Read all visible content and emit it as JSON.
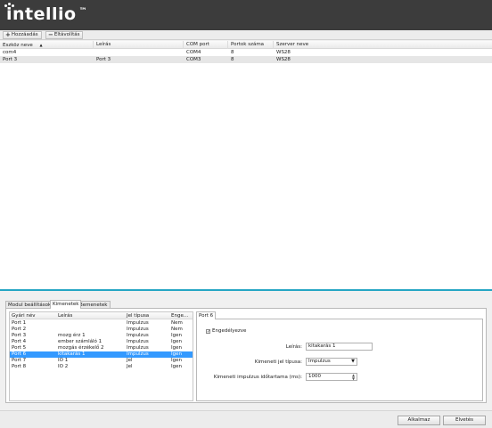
{
  "brand": {
    "name": "intellio",
    "tm": "™"
  },
  "toolbar": {
    "add_label": "Hozzáadás",
    "remove_label": "Eltávolítás"
  },
  "grid": {
    "headers": [
      "Eszköz neve",
      "Leírás",
      "COM port",
      "Portok száma",
      "Szerver neve"
    ],
    "rows": [
      [
        "com4",
        "",
        "COM4",
        "8",
        "WS28"
      ],
      [
        "Port 3",
        "Port 3",
        "COM3",
        "8",
        "WS28"
      ]
    ]
  },
  "tabs": [
    "Modul beállítások",
    "Kimenetek",
    "Bemenetek"
  ],
  "ports": {
    "headers": [
      "Gyári név",
      "Leírás",
      "Jel típusa",
      "Enge..."
    ],
    "rows": [
      [
        "Port 1",
        "",
        "Impulzus",
        "Nem"
      ],
      [
        "Port 2",
        "",
        "Impulzus",
        "Nem"
      ],
      [
        "Port 3",
        "mozg érz 1",
        "Impulzus",
        "Igen"
      ],
      [
        "Port 4",
        "ember számláló 1",
        "Impulzus",
        "Igen"
      ],
      [
        "Port 5",
        "mozgás érzékelő 2",
        "Impulzus",
        "Igen"
      ],
      [
        "Port 6",
        "kitakarás 1",
        "Impulzus",
        "Igen"
      ],
      [
        "Port 7",
        "IO 1",
        "Jel",
        "Igen"
      ],
      [
        "Port 8",
        "IO 2",
        "Jel",
        "Igen"
      ]
    ],
    "selected_index": 5
  },
  "detail": {
    "tab_label": "Port 6",
    "enabled_label": "Engedélyezve",
    "enabled_checked": true,
    "description_label": "Leírás:",
    "description_value": "kitakarás 1",
    "signal_type_label": "Kimeneti jel típusa:",
    "signal_type_value": "Impulzus",
    "pulse_duration_label": "Kimeneti impulzus időtartama (ms):",
    "pulse_duration_value": "1000"
  },
  "footer": {
    "apply_label": "Alkalmaz",
    "cancel_label": "Elvetés"
  },
  "colors": {
    "brand_bar": "#3c3c3c",
    "divider": "#25a6c4",
    "selection": "#3399ff"
  }
}
